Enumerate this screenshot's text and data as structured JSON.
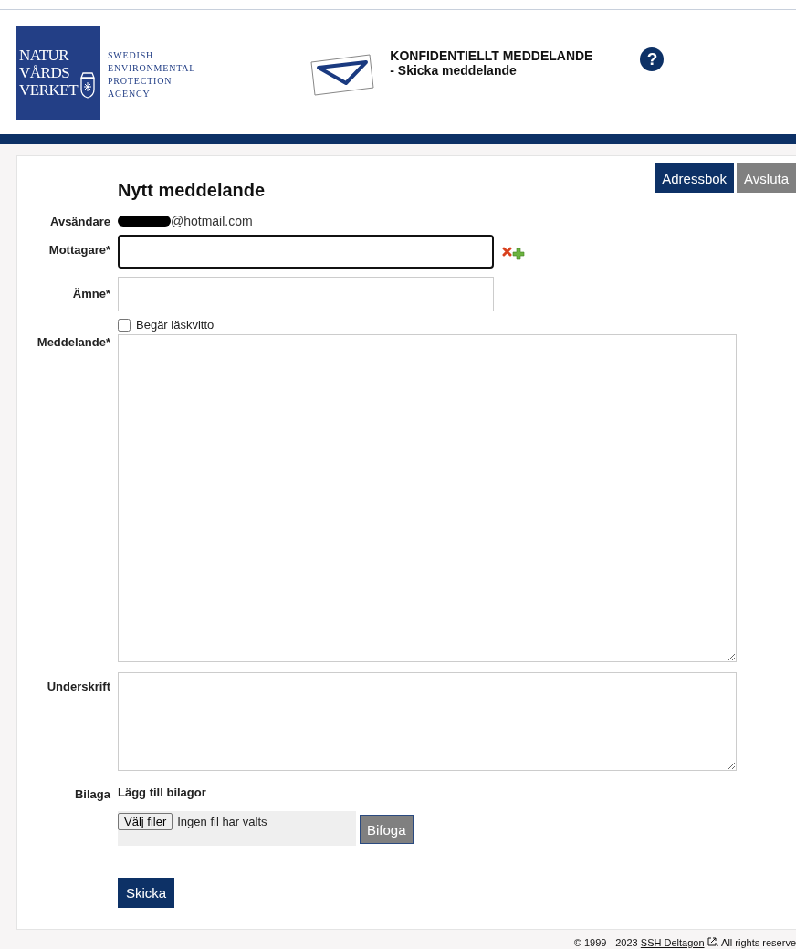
{
  "header": {
    "logo_lines": [
      "NATUR",
      "VÅRDS",
      "VERKET"
    ],
    "agency_lines": [
      "SWEDISH",
      "ENVIRONMENTAL",
      "PROTECTION",
      "AGENCY"
    ],
    "title": "KONFIDENTIELLT MEDDELANDE",
    "subtitle": "- Skicka meddelande",
    "help": "?"
  },
  "toolbar": [
    {
      "label": "Adressbok",
      "kind": "primary"
    },
    {
      "label": "Avsluta",
      "kind": "secondary"
    }
  ],
  "form": {
    "heading": "Nytt meddelande",
    "sender": {
      "label": "Avsändare",
      "value": "@hotmail.com"
    },
    "recipient": {
      "label": "Mottagare*",
      "focused": true
    },
    "subject": {
      "label": "Ämne*"
    },
    "read_receipt": {
      "label": "Begär läskvitto",
      "checked": false
    },
    "message": {
      "label": "Meddelande*"
    },
    "signature": {
      "label": "Underskrift"
    },
    "attachment": {
      "label": "Bilaga",
      "heading": "Lägg till bilagor",
      "choose_button": "Välj filer",
      "file_status": "Ingen fil har valts",
      "attach_button": "Bifoga"
    },
    "send_button": "Skicka"
  },
  "footer": {
    "copyright": "© 1999 - 2023",
    "link": "SSH Deltagon",
    "rest": ". All rights reserve"
  }
}
